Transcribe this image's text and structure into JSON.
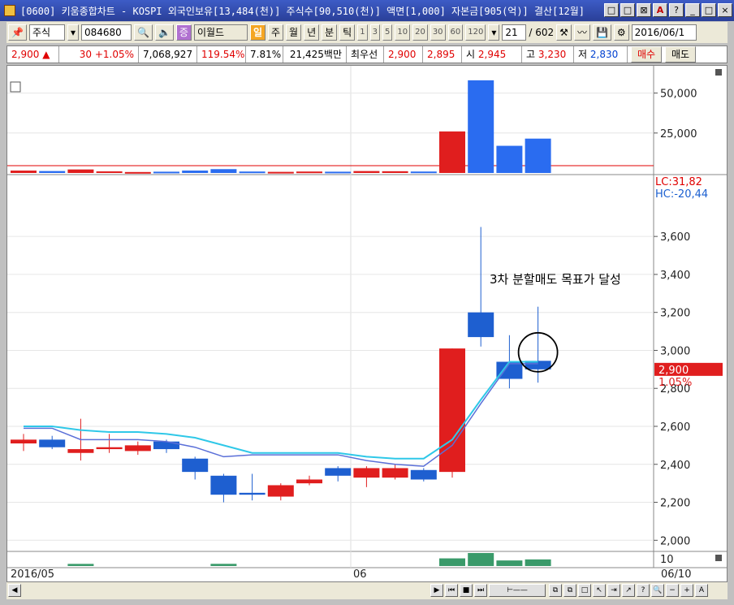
{
  "window": {
    "title": "[0600] 키움종합차트 - KOSPI 외국인보유[13,484(천)] 주식수[90,510(천)] 액면[1,000] 자본금[905(억)] 결산[12월]",
    "buttons": [
      "□",
      "□",
      "⊠",
      "A",
      "?",
      "_",
      "□",
      "×"
    ]
  },
  "toolbar": {
    "market": "주식",
    "code": "084680",
    "tag": "증",
    "name": "이월드",
    "day_label": "일",
    "periods": [
      "주",
      "월",
      "년",
      "분",
      "틱"
    ],
    "minutes": [
      "1",
      "3",
      "5",
      "10",
      "20",
      "30",
      "60",
      "120"
    ],
    "count": "21",
    "total": "/ 602",
    "date": "2016/06/1"
  },
  "quote": {
    "price": "2,900",
    "arrow": "▲",
    "change": "30 +1.05%",
    "volume": "7,068,927",
    "vol_ratio": "119.54%",
    "turnover": "7.81%",
    "amount": "21,425백만",
    "best_label": "최우선",
    "best_ask": "2,900",
    "best_bid": "2,895",
    "open_label": "시",
    "open": "2,945",
    "high_label": "고",
    "high": "3,230",
    "low_label": "저",
    "low": "2,830",
    "buy": "매수",
    "sell": "매도"
  },
  "chart_data": {
    "type": "candlestick",
    "volume_ticks": [
      "50,000",
      "25,000"
    ],
    "price_ticks": [
      "3,600",
      "3,400",
      "3,200",
      "3,000",
      "2,800",
      "2,600",
      "2,400",
      "2,200",
      "2,000"
    ],
    "price_range": [
      1950,
      3900
    ],
    "lc_label": "LC:31,82",
    "hc_label": "HC:-20,44",
    "current_price_label": "2,900",
    "current_change_label": "1.05%",
    "annotation": "3차 분할매도 목표가 달성",
    "x_labels": [
      "2016/05",
      "06",
      "06/10"
    ],
    "bottom_tick": "10",
    "candles": [
      {
        "o": 2510,
        "c": 2530,
        "h": 2560,
        "l": 2470,
        "v": 1500
      },
      {
        "o": 2530,
        "c": 2490,
        "h": 2550,
        "l": 2480,
        "v": 1200
      },
      {
        "o": 2460,
        "c": 2480,
        "h": 2640,
        "l": 2420,
        "v": 2200
      },
      {
        "o": 2480,
        "c": 2490,
        "h": 2560,
        "l": 2460,
        "v": 1000
      },
      {
        "o": 2470,
        "c": 2500,
        "h": 2520,
        "l": 2450,
        "v": 600
      },
      {
        "o": 2520,
        "c": 2480,
        "h": 2530,
        "l": 2460,
        "v": 800
      },
      {
        "o": 2430,
        "c": 2360,
        "h": 2440,
        "l": 2320,
        "v": 1500
      },
      {
        "o": 2340,
        "c": 2240,
        "h": 2350,
        "l": 2200,
        "v": 2400
      },
      {
        "o": 2250,
        "c": 2240,
        "h": 2350,
        "l": 2210,
        "v": 900
      },
      {
        "o": 2230,
        "c": 2290,
        "h": 2300,
        "l": 2210,
        "v": 700
      },
      {
        "o": 2300,
        "c": 2320,
        "h": 2340,
        "l": 2290,
        "v": 900
      },
      {
        "o": 2380,
        "c": 2340,
        "h": 2390,
        "l": 2310,
        "v": 800
      },
      {
        "o": 2330,
        "c": 2380,
        "h": 2390,
        "l": 2280,
        "v": 1200
      },
      {
        "o": 2330,
        "c": 2380,
        "h": 2400,
        "l": 2320,
        "v": 1100
      },
      {
        "o": 2370,
        "c": 2320,
        "h": 2380,
        "l": 2310,
        "v": 900
      },
      {
        "o": 2360,
        "c": 3010,
        "h": 3010,
        "l": 2330,
        "v": 26000
      },
      {
        "o": 3200,
        "c": 3070,
        "h": 3650,
        "l": 3020,
        "v": 58000
      },
      {
        "o": 2940,
        "c": 2850,
        "h": 3080,
        "l": 2800,
        "v": 17000
      },
      {
        "o": 2945,
        "c": 2900,
        "h": 3230,
        "l": 2830,
        "v": 21500
      }
    ],
    "upper_band": [
      2600,
      2600,
      2580,
      2570,
      2570,
      2560,
      2540,
      2500,
      2460,
      2460,
      2460,
      2460,
      2440,
      2430,
      2430,
      2530,
      2740,
      2940,
      2940
    ],
    "lower_band": [
      2590,
      2590,
      2530,
      2530,
      2530,
      2520,
      2490,
      2440,
      2450,
      2450,
      2450,
      2450,
      2420,
      2400,
      2390,
      2500,
      2720,
      2930,
      2930
    ]
  }
}
